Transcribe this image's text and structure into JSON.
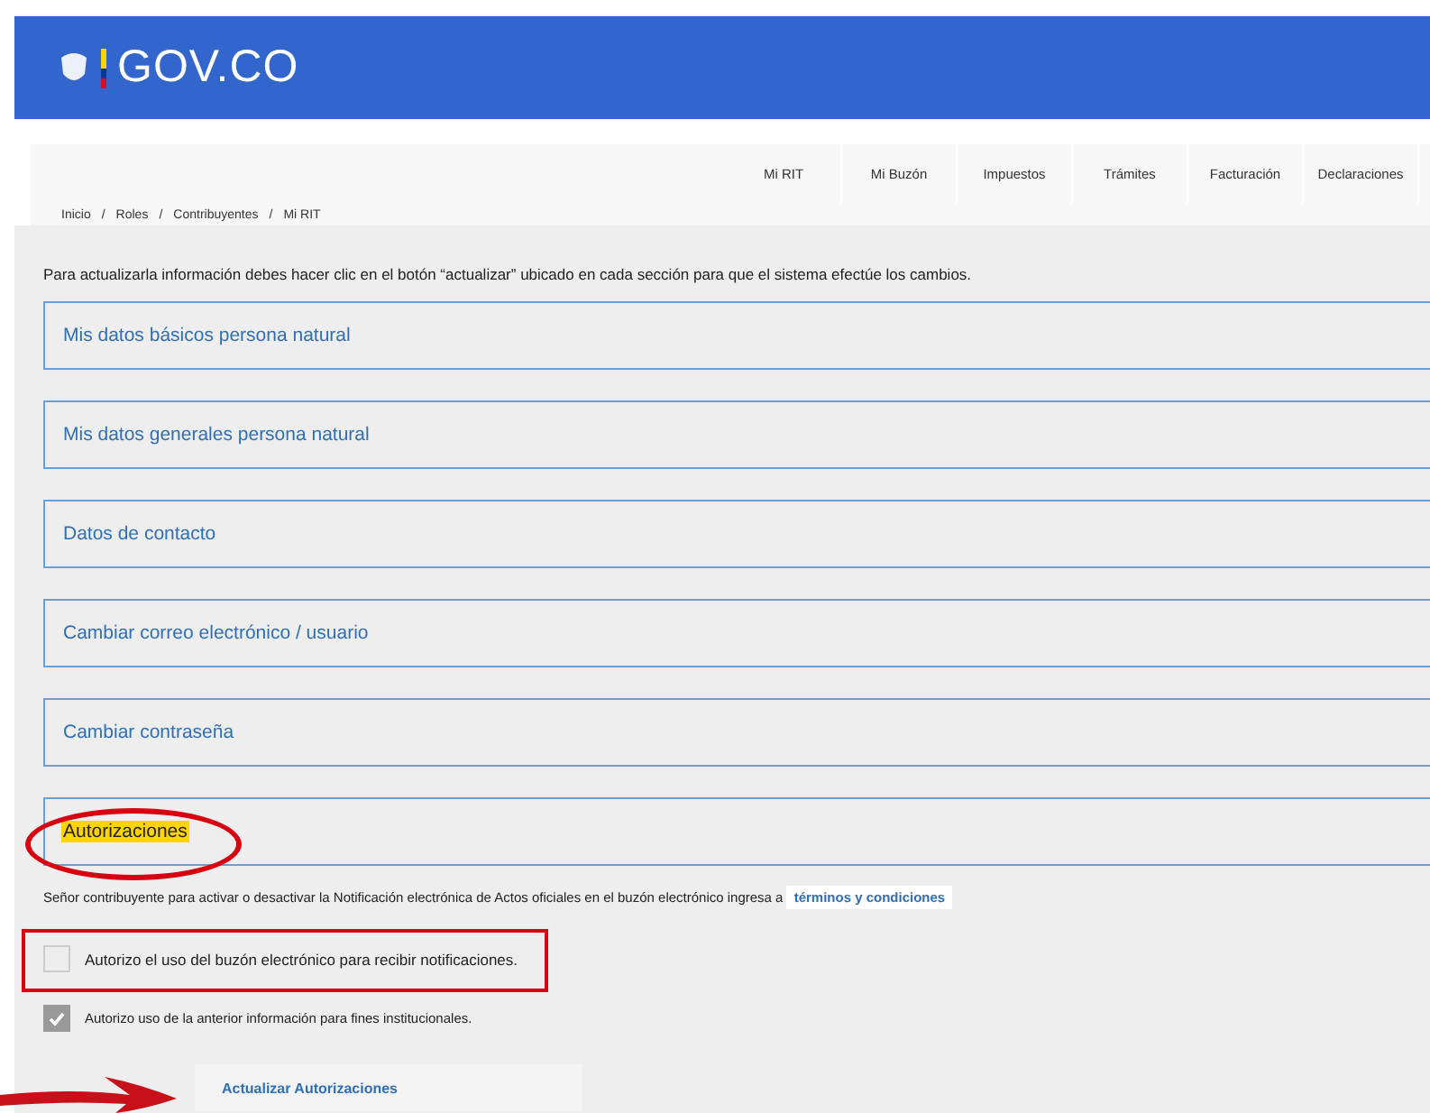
{
  "header": {
    "logo_text": "GOV.CO"
  },
  "nav": [
    {
      "label": "Mi RIT"
    },
    {
      "label": "Mi Buzón"
    },
    {
      "label": "Impuestos"
    },
    {
      "label": "Trámites"
    },
    {
      "label": "Facturación"
    },
    {
      "label": "Declaraciones"
    }
  ],
  "breadcrumb": [
    "Inicio",
    "Roles",
    "Contribuyentes",
    "Mi RIT"
  ],
  "breadcrumb_separator": "/",
  "intro": "Para actualizarla información debes hacer clic en el botón “actualizar” ubicado en cada sección para que el sistema efectúe los cambios.",
  "sections": [
    {
      "title": "Mis datos básicos persona natural",
      "highlighted": false
    },
    {
      "title": "Mis datos generales persona natural",
      "highlighted": false
    },
    {
      "title": "Datos de contacto",
      "highlighted": false
    },
    {
      "title": "Cambiar correo electrónico / usuario",
      "highlighted": false
    },
    {
      "title": "Cambiar contraseña",
      "highlighted": false
    },
    {
      "title": "Autorizaciones",
      "highlighted": true
    }
  ],
  "notice": {
    "text": "Señor contribuyente para activar o desactivar la Notificación electrónica de Actos oficiales en el buzón electrónico ingresa a",
    "link": "términos y condiciones"
  },
  "checkboxes": [
    {
      "label": "Autorizo el uso del buzón electrónico para recibir notificaciones.",
      "checked": false,
      "large": true
    },
    {
      "label": "Autorizo uso de la anterior información para fines institucionales.",
      "checked": true,
      "large": false
    }
  ],
  "button": "Actualizar Autorizaciones"
}
